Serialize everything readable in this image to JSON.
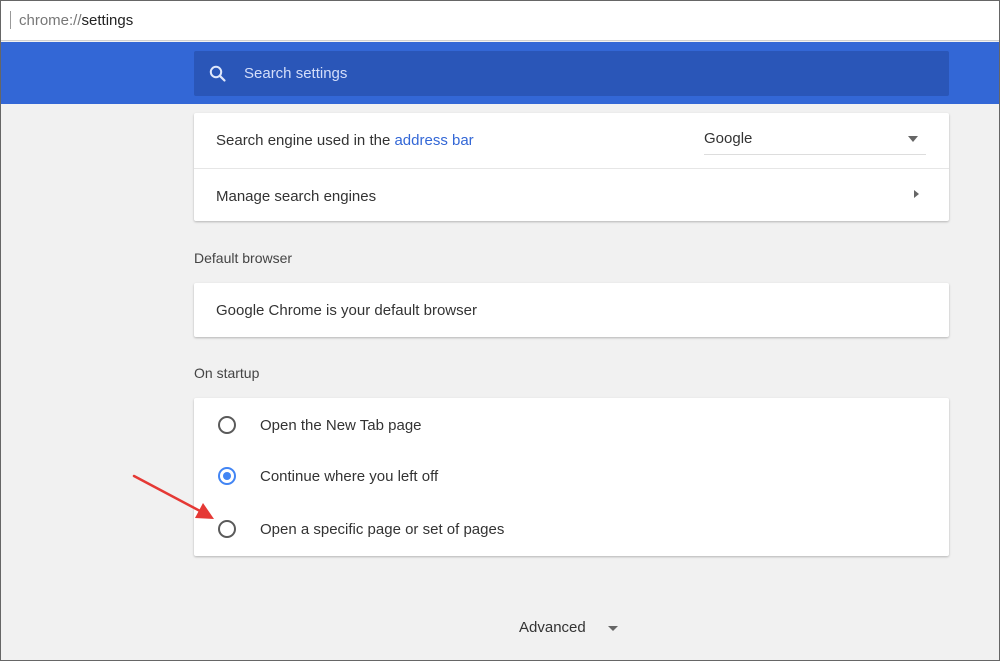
{
  "address_bar": {
    "scheme": "chrome://",
    "path": "settings"
  },
  "search": {
    "placeholder": "Search settings"
  },
  "search_engine": {
    "label_prefix": "Search engine used in the ",
    "label_link": "address bar",
    "selected": "Google",
    "manage_label": "Manage search engines"
  },
  "default_browser": {
    "title": "Default browser",
    "status": "Google Chrome is your default browser"
  },
  "startup": {
    "title": "On startup",
    "options": [
      {
        "label": "Open the New Tab page",
        "checked": false
      },
      {
        "label": "Continue where you left off",
        "checked": true
      },
      {
        "label": "Open a specific page or set of pages",
        "checked": false
      }
    ]
  },
  "advanced": {
    "label": "Advanced"
  },
  "colors": {
    "header": "#3367d6",
    "link": "#3367d6",
    "radio_checked": "#4285f4",
    "annotation_arrow": "#e53935"
  }
}
